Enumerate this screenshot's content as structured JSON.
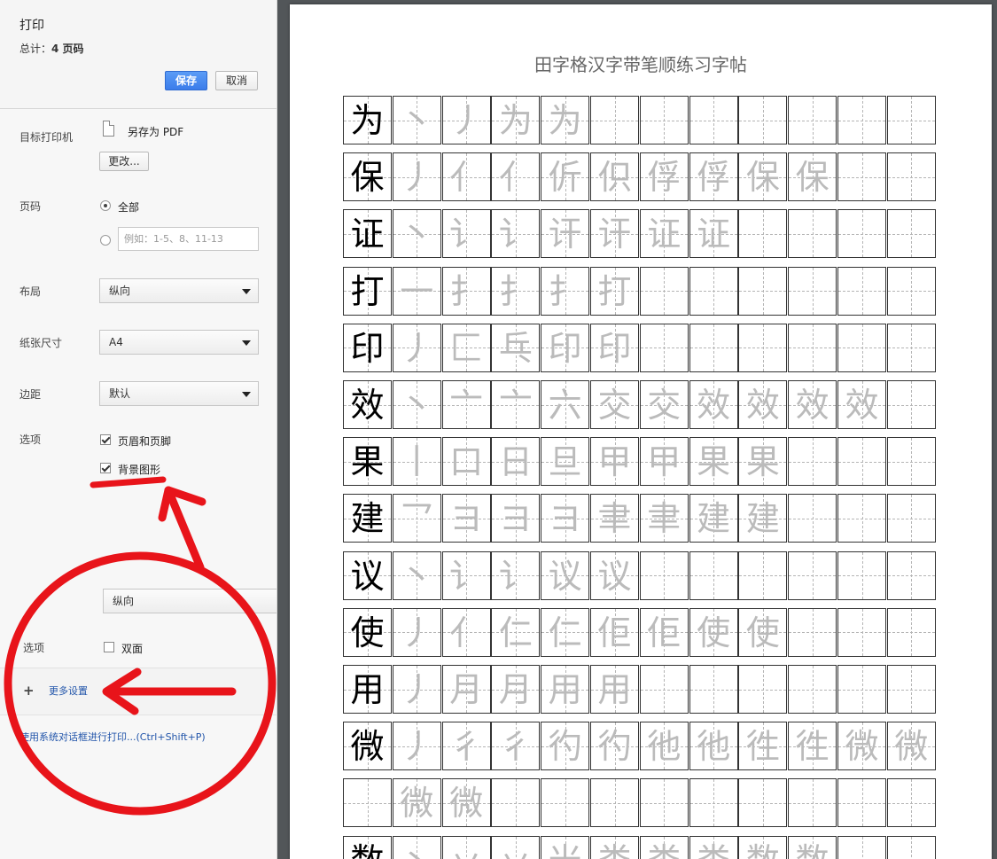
{
  "header": {
    "title": "打印",
    "total_label": "总计：",
    "total_value": "4 页码",
    "save": "保存",
    "cancel": "取消"
  },
  "destination": {
    "label": "目标打印机",
    "name": "另存为 PDF",
    "change": "更改..."
  },
  "pages": {
    "label": "页码",
    "all": "全部",
    "placeholder": "例如：1-5、8、11-13"
  },
  "layout": {
    "label": "布局",
    "value": "纵向"
  },
  "paper": {
    "label": "纸张尺寸",
    "value": "A4"
  },
  "margins": {
    "label": "边距",
    "value": "默认"
  },
  "options": {
    "label": "选项",
    "headers_footers": "页眉和页脚",
    "background": "背景图形"
  },
  "zoom_panel": {
    "layout_value": "纵向",
    "options_label": "选项",
    "duplex": "双面",
    "more_settings": "更多设置",
    "system_dialog": "使用系统对话框进行打印...(Ctrl+Shift+P)"
  },
  "preview": {
    "title": "田字格汉字带笔顺练习字帖",
    "rows": [
      [
        "为",
        "丶",
        "丿",
        "为",
        "为"
      ],
      [
        "保",
        "丿",
        "亻",
        "亻",
        "伒",
        "伿",
        "俘",
        "俘",
        "保",
        "保"
      ],
      [
        "证",
        "丶",
        "讠",
        "讠",
        "讦",
        "讦",
        "证",
        "证"
      ],
      [
        "打",
        "一",
        "扌",
        "扌",
        "扌",
        "打"
      ],
      [
        "印",
        "丿",
        "匚",
        "乓",
        "印",
        "印"
      ],
      [
        "效",
        "丶",
        "亠",
        "亠",
        "六",
        "交",
        "交",
        "效",
        "效",
        "效",
        "效"
      ],
      [
        "果",
        "丨",
        "口",
        "日",
        "旦",
        "甲",
        "甲",
        "果",
        "果"
      ],
      [
        "建",
        "乛",
        "ヨ",
        "ヨ",
        "ヨ",
        "聿",
        "聿",
        "建",
        "建"
      ],
      [
        "议",
        "丶",
        "讠",
        "讠",
        "议",
        "议"
      ],
      [
        "使",
        "丿",
        "亻",
        "仁",
        "仁",
        "佢",
        "佢",
        "使",
        "使"
      ],
      [
        "用",
        "丿",
        "月",
        "月",
        "用",
        "用"
      ],
      [
        "微",
        "丿",
        "彳",
        "彳",
        "彴",
        "彴",
        "彵",
        "彵",
        "徃",
        "徃",
        "微",
        "微"
      ],
      [
        "",
        "微",
        "微"
      ],
      [
        "数",
        "丶",
        "丷",
        "丷",
        "米",
        "娄",
        "娄",
        "娄",
        "数",
        "数"
      ]
    ]
  },
  "colors": {
    "annotation": "#e8141a",
    "save_button": "#3b7cea",
    "link": "#2255aa"
  }
}
